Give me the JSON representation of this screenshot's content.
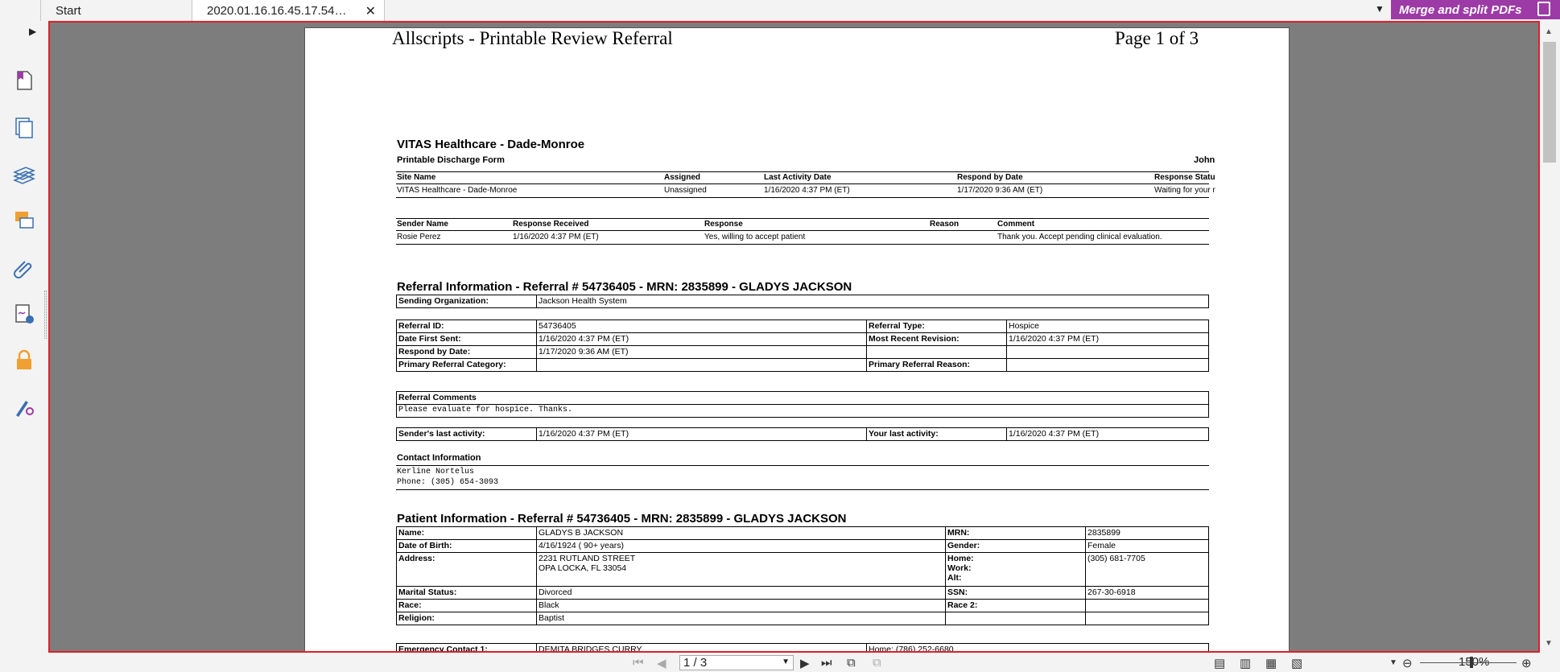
{
  "tabs": {
    "start_label": "Start",
    "doc_label": "2020.01.16.16.45.17.54…",
    "close_glyph": "✕"
  },
  "toolbar": {
    "merge_label": "Merge and split PDFs"
  },
  "sidebar": {
    "icons": [
      "expand-arrow-icon",
      "page-thumbnail-icon",
      "pages-icon",
      "layers-icon",
      "comments-icon",
      "attachments-icon",
      "signature-panel-icon",
      "security-lock-icon",
      "certify-icon"
    ]
  },
  "document": {
    "header_title": "Allscripts - Printable Review Referral",
    "header_page": "Page 1 of 3",
    "org_title": "VITAS Healthcare - Dade-Monroe",
    "form_title": "Printable Discharge Form",
    "user_name": "John",
    "site_table": {
      "headers": [
        "Site Name",
        "Assigned",
        "Last Activity Date",
        "Respond by Date",
        "Response Statu"
      ],
      "row": [
        "VITAS Healthcare - Dade-Monroe",
        "Unassigned",
        "1/16/2020 4:37 PM (ET)",
        "1/17/2020 9:36 AM (ET)",
        "Waiting for your r"
      ]
    },
    "sender_table": {
      "headers": [
        "Sender Name",
        "Response Received",
        "Response",
        "Reason",
        "Comment"
      ],
      "row": [
        "Rosie Perez",
        "1/16/2020 4:37 PM (ET)",
        "Yes, willing to accept patient",
        "",
        "Thank you. Accept pending clinical evaluation."
      ]
    },
    "referral_heading": "Referral Information - Referral # 54736405 - MRN: 2835899 - GLADYS JACKSON",
    "sending_org_label": "Sending Organization:",
    "sending_org_value": "Jackson Health System",
    "referral_id_label": "Referral ID:",
    "referral_id_value": "54736405",
    "referral_type_label": "Referral Type:",
    "referral_type_value": "Hospice",
    "date_first_sent_label": "Date First Sent:",
    "date_first_sent_value": "1/16/2020 4:37 PM (ET)",
    "most_recent_rev_label": "Most Recent Revision:",
    "most_recent_rev_value": "1/16/2020 4:37 PM (ET)",
    "respond_by_label": "Respond by Date:",
    "respond_by_value": "1/17/2020 9:36 AM (ET)",
    "primary_cat_label": "Primary Referral Category:",
    "primary_reason_label": "Primary Referral Reason:",
    "ref_comments_label": "Referral Comments",
    "ref_comments_value": "Please evaluate for hospice. Thanks.",
    "sender_last_label": "Sender's last activity:",
    "sender_last_value": "1/16/2020 4:37 PM (ET)",
    "your_last_label": "Your last activity:",
    "your_last_value": "1/16/2020 4:37 PM (ET)",
    "contact_heading": "Contact Information",
    "contact_name": "Kerline Nortelus",
    "contact_phone": "Phone: (305) 654-3093",
    "patient_heading": "Patient Information - Referral # 54736405 - MRN: 2835899 - GLADYS JACKSON",
    "name_label": "Name:",
    "name_value": "GLADYS B JACKSON",
    "mrn_label": "MRN:",
    "mrn_value": "2835899",
    "dob_label": "Date of Birth:",
    "dob_value": "4/16/1924 ( 90+ years)",
    "gender_label": "Gender:",
    "gender_value": "Female",
    "address_label": "Address:",
    "address_line1": "2231 RUTLAND STREET",
    "address_line2": "OPA LOCKA, FL 33054",
    "home_label": "Home:",
    "work_label": "Work:",
    "alt_label": "Alt:",
    "home_value": "(305) 681-7705",
    "marital_label": "Marital Status:",
    "marital_value": "Divorced",
    "ssn_label": "SSN:",
    "ssn_value": "267-30-6918",
    "race_label": "Race:",
    "race_value": "Black",
    "race2_label": "Race 2:",
    "religion_label": "Religion:",
    "religion_value": "Baptist",
    "emergency_label": "Emergency Contact 1:",
    "emergency_value": "DEMITA BRIDGES CURRY",
    "emergency_home": "Home: (786) 252-6680"
  },
  "statusbar": {
    "page_value": "1 / 3",
    "zoom_value": "150%"
  }
}
